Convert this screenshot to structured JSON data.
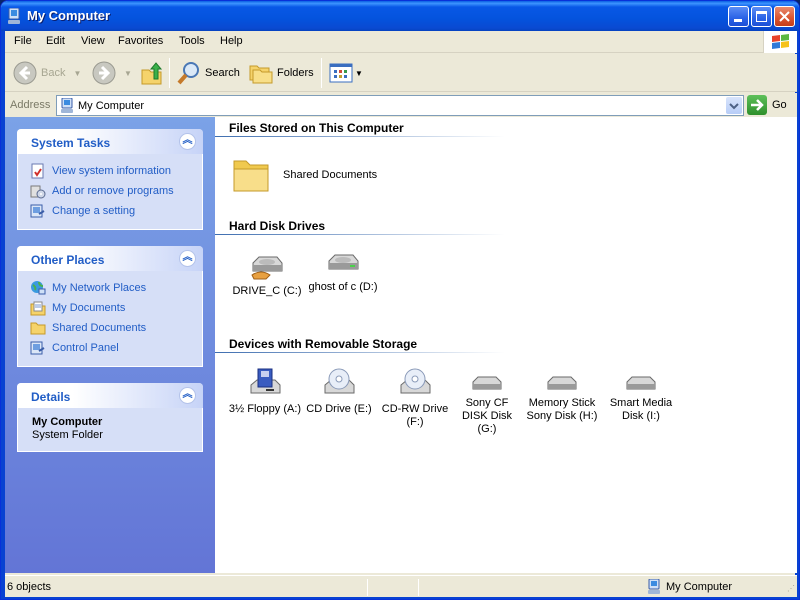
{
  "window": {
    "title": "My Computer",
    "controls": {
      "minimize": "minimize",
      "maximize": "maximize",
      "close": "close"
    }
  },
  "menu": [
    {
      "label": "File",
      "accel": "F"
    },
    {
      "label": "Edit",
      "accel": "E"
    },
    {
      "label": "View",
      "accel": "V"
    },
    {
      "label": "Favorites",
      "accel": "a"
    },
    {
      "label": "Tools",
      "accel": "T"
    },
    {
      "label": "Help",
      "accel": "H"
    }
  ],
  "toolbar": {
    "back_label": "Back",
    "search_label": "Search",
    "folders_label": "Folders"
  },
  "address": {
    "label": "Address",
    "value": "My Computer",
    "go_label": "Go"
  },
  "taskpane": {
    "system_tasks": {
      "title": "System Tasks",
      "items": [
        {
          "label": "View system information",
          "icon": "system-info-icon"
        },
        {
          "label": "Add or remove programs",
          "icon": "add-remove-programs-icon"
        },
        {
          "label": "Change a setting",
          "icon": "control-panel-icon"
        }
      ]
    },
    "other_places": {
      "title": "Other Places",
      "items": [
        {
          "label": "My Network Places",
          "icon": "network-places-icon"
        },
        {
          "label": "My Documents",
          "icon": "my-documents-icon"
        },
        {
          "label": "Shared Documents",
          "icon": "folder-icon"
        },
        {
          "label": "Control Panel",
          "icon": "control-panel-icon"
        }
      ]
    },
    "details": {
      "title": "Details",
      "name": "My Computer",
      "type": "System Folder"
    }
  },
  "content": {
    "groups": [
      {
        "title": "Files Stored on This Computer",
        "items": [
          {
            "label": "Shared Documents",
            "icon": "folder-icon"
          }
        ]
      },
      {
        "title": "Hard Disk Drives",
        "items": [
          {
            "label": "DRIVE_C (C:)",
            "icon": "shared-hard-drive-icon"
          },
          {
            "label": "ghost of c (D:)",
            "icon": "hard-drive-icon"
          }
        ]
      },
      {
        "title": "Devices with Removable Storage",
        "items": [
          {
            "label": "3½ Floppy (A:)",
            "icon": "floppy-drive-icon"
          },
          {
            "label": "CD Drive (E:)",
            "icon": "cd-drive-icon"
          },
          {
            "label": "CD-RW Drive (F:)",
            "icon": "cd-drive-icon"
          },
          {
            "label": "Sony CF DISK Disk (G:)",
            "icon": "removable-disk-icon"
          },
          {
            "label": "Memory Stick Sony Disk (H:)",
            "icon": "removable-disk-icon"
          },
          {
            "label": "Smart Media Disk (I:)",
            "icon": "removable-disk-icon"
          }
        ]
      }
    ]
  },
  "status": {
    "objects": "6 objects",
    "location": "My Computer"
  }
}
